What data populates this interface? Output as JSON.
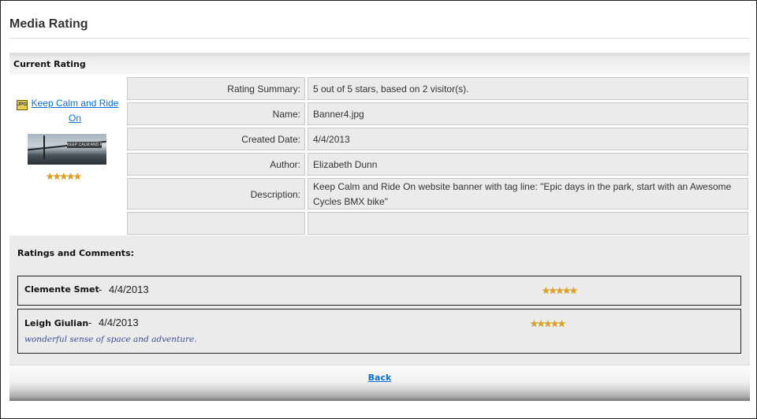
{
  "page": {
    "title": "Media Rating"
  },
  "current_rating": {
    "heading": "Current Rating",
    "media": {
      "icon": "jpg-file-icon",
      "icon_label": "JPG",
      "link_text": "Keep Calm and Ride On",
      "thumbnail_caption": "KEEP CALM AND RIDE ON",
      "stars": "★★★★★",
      "rating": 5
    },
    "fields": [
      {
        "label": "Rating Summary:",
        "value": "5 out of 5 stars, based on 2 visitor(s)."
      },
      {
        "label": "Name:",
        "value": "Banner4.jpg"
      },
      {
        "label": "Created Date:",
        "value": "4/4/2013"
      },
      {
        "label": "Author:",
        "value": "Elizabeth Dunn"
      },
      {
        "label": "Description:",
        "value": "Keep Calm and Ride On website banner with tag line: \"Epic days in the park, start with an Awesome Cycles BMX bike\""
      },
      {
        "label": "",
        "value": ""
      }
    ]
  },
  "ratings_comments": {
    "heading": "Ratings and Comments:",
    "items": [
      {
        "author": "Clemente Smet",
        "separator": "-",
        "date": "4/4/2013",
        "stars": "★★★★★",
        "rating": 5,
        "comment": ""
      },
      {
        "author": "Leigh Giulian",
        "separator": "-",
        "date": "4/4/2013",
        "stars": "★★★★★",
        "rating": 5,
        "comment": "wonderful sense of space and adventure."
      }
    ]
  },
  "footer": {
    "back_label": "Back"
  },
  "colors": {
    "link": "#0b6ecf",
    "star": "#e2a017",
    "comment_text": "#3a4f8f",
    "panel": "#ebebeb"
  }
}
